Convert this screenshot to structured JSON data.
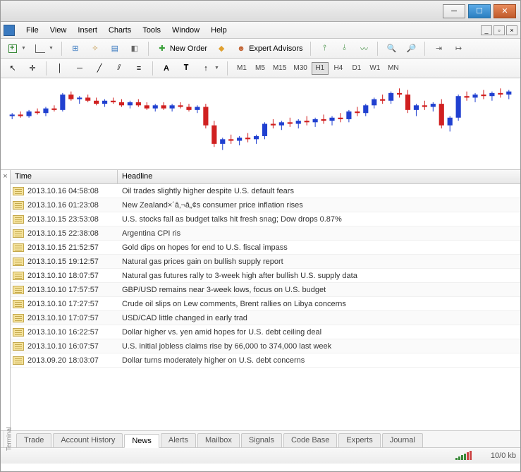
{
  "window": {
    "title": ""
  },
  "menu": [
    "File",
    "View",
    "Insert",
    "Charts",
    "Tools",
    "Window",
    "Help"
  ],
  "toolbar1": {
    "new_order": "New Order",
    "expert_advisors": "Expert Advisors"
  },
  "timeframes": [
    "M1",
    "M5",
    "M15",
    "M30",
    "H1",
    "H4",
    "D1",
    "W1",
    "MN"
  ],
  "active_timeframe": "H1",
  "news_headers": {
    "time": "Time",
    "headline": "Headline"
  },
  "news": [
    {
      "time": "2013.10.16 04:58:08",
      "headline": "Oil trades slightly higher despite U.S. default fears"
    },
    {
      "time": "2013.10.16 01:23:08",
      "headline": "New Zealand×´â‚¬â„¢s consumer price inflation rises"
    },
    {
      "time": "2013.10.15 23:53:08",
      "headline": "U.S. stocks fall as budget talks hit fresh snag; Dow drops 0.87%"
    },
    {
      "time": "2013.10.15 22:38:08",
      "headline": "Argentina CPI ris"
    },
    {
      "time": "2013.10.15 21:52:57",
      "headline": "Gold dips on hopes for end to U.S. fiscal impass"
    },
    {
      "time": "2013.10.15 19:12:57",
      "headline": "Natural gas prices gain on bullish supply report"
    },
    {
      "time": "2013.10.10 18:07:57",
      "headline": "Natural gas futures rally to 3-week high after bullish U.S. supply data"
    },
    {
      "time": "2013.10.10 17:57:57",
      "headline": "GBP/USD remains near 3-week lows, focus on U.S. budget"
    },
    {
      "time": "2013.10.10 17:27:57",
      "headline": "Crude oil slips on Lew comments, Brent rallies on Libya concerns"
    },
    {
      "time": "2013.10.10 17:07:57",
      "headline": "USD/CAD little changed in early trad"
    },
    {
      "time": "2013.10.10 16:22:57",
      "headline": "Dollar higher vs. yen amid hopes for U.S. debt ceiling deal"
    },
    {
      "time": "2013.10.10 16:07:57",
      "headline": "U.S. initial jobless claims rise by 66,000 to 374,000 last week"
    },
    {
      "time": "2013.09.20 18:03:07",
      "headline": "Dollar turns moderately higher on U.S. debt concerns"
    }
  ],
  "tabs": [
    "Trade",
    "Account History",
    "News",
    "Alerts",
    "Mailbox",
    "Signals",
    "Code Base",
    "Experts",
    "Journal"
  ],
  "active_tab": "News",
  "terminal_label": "Terminal",
  "status": {
    "traffic": "10/0 kb"
  },
  "chart_data": {
    "type": "candlestick",
    "title": "",
    "series": [
      {
        "o": 50,
        "h": 52,
        "l": 48,
        "c": 51,
        "d": "u"
      },
      {
        "o": 51,
        "h": 53,
        "l": 49,
        "c": 50,
        "d": "d"
      },
      {
        "o": 50,
        "h": 54,
        "l": 49,
        "c": 53,
        "d": "u"
      },
      {
        "o": 53,
        "h": 55,
        "l": 51,
        "c": 52,
        "d": "d"
      },
      {
        "o": 52,
        "h": 56,
        "l": 50,
        "c": 55,
        "d": "u"
      },
      {
        "o": 55,
        "h": 57,
        "l": 53,
        "c": 54,
        "d": "d"
      },
      {
        "o": 54,
        "h": 65,
        "l": 53,
        "c": 64,
        "d": "u"
      },
      {
        "o": 64,
        "h": 66,
        "l": 60,
        "c": 61,
        "d": "d"
      },
      {
        "o": 61,
        "h": 63,
        "l": 58,
        "c": 62,
        "d": "u"
      },
      {
        "o": 62,
        "h": 64,
        "l": 59,
        "c": 60,
        "d": "d"
      },
      {
        "o": 60,
        "h": 62,
        "l": 57,
        "c": 58,
        "d": "d"
      },
      {
        "o": 58,
        "h": 61,
        "l": 56,
        "c": 60,
        "d": "u"
      },
      {
        "o": 60,
        "h": 62,
        "l": 58,
        "c": 59,
        "d": "d"
      },
      {
        "o": 59,
        "h": 61,
        "l": 56,
        "c": 57,
        "d": "d"
      },
      {
        "o": 57,
        "h": 60,
        "l": 55,
        "c": 59,
        "d": "u"
      },
      {
        "o": 59,
        "h": 61,
        "l": 56,
        "c": 57,
        "d": "d"
      },
      {
        "o": 57,
        "h": 59,
        "l": 54,
        "c": 55,
        "d": "d"
      },
      {
        "o": 55,
        "h": 58,
        "l": 53,
        "c": 57,
        "d": "u"
      },
      {
        "o": 57,
        "h": 59,
        "l": 54,
        "c": 55,
        "d": "d"
      },
      {
        "o": 55,
        "h": 58,
        "l": 53,
        "c": 57,
        "d": "u"
      },
      {
        "o": 57,
        "h": 59,
        "l": 55,
        "c": 56,
        "d": "d"
      },
      {
        "o": 56,
        "h": 58,
        "l": 53,
        "c": 54,
        "d": "d"
      },
      {
        "o": 54,
        "h": 57,
        "l": 52,
        "c": 56,
        "d": "u"
      },
      {
        "o": 56,
        "h": 58,
        "l": 42,
        "c": 44,
        "d": "d"
      },
      {
        "o": 44,
        "h": 47,
        "l": 30,
        "c": 32,
        "d": "d"
      },
      {
        "o": 32,
        "h": 36,
        "l": 28,
        "c": 35,
        "d": "u"
      },
      {
        "o": 35,
        "h": 38,
        "l": 32,
        "c": 34,
        "d": "d"
      },
      {
        "o": 34,
        "h": 37,
        "l": 31,
        "c": 36,
        "d": "u"
      },
      {
        "o": 36,
        "h": 39,
        "l": 33,
        "c": 35,
        "d": "d"
      },
      {
        "o": 35,
        "h": 38,
        "l": 32,
        "c": 37,
        "d": "u"
      },
      {
        "o": 37,
        "h": 46,
        "l": 35,
        "c": 45,
        "d": "u"
      },
      {
        "o": 45,
        "h": 48,
        "l": 42,
        "c": 44,
        "d": "d"
      },
      {
        "o": 44,
        "h": 47,
        "l": 41,
        "c": 46,
        "d": "u"
      },
      {
        "o": 46,
        "h": 49,
        "l": 43,
        "c": 45,
        "d": "d"
      },
      {
        "o": 45,
        "h": 48,
        "l": 42,
        "c": 47,
        "d": "u"
      },
      {
        "o": 47,
        "h": 50,
        "l": 44,
        "c": 46,
        "d": "d"
      },
      {
        "o": 46,
        "h": 49,
        "l": 43,
        "c": 48,
        "d": "u"
      },
      {
        "o": 48,
        "h": 51,
        "l": 45,
        "c": 47,
        "d": "d"
      },
      {
        "o": 47,
        "h": 50,
        "l": 44,
        "c": 49,
        "d": "u"
      },
      {
        "o": 49,
        "h": 52,
        "l": 46,
        "c": 48,
        "d": "d"
      },
      {
        "o": 48,
        "h": 54,
        "l": 46,
        "c": 53,
        "d": "u"
      },
      {
        "o": 53,
        "h": 56,
        "l": 50,
        "c": 52,
        "d": "d"
      },
      {
        "o": 52,
        "h": 58,
        "l": 50,
        "c": 57,
        "d": "u"
      },
      {
        "o": 57,
        "h": 62,
        "l": 55,
        "c": 61,
        "d": "u"
      },
      {
        "o": 61,
        "h": 64,
        "l": 58,
        "c": 60,
        "d": "d"
      },
      {
        "o": 60,
        "h": 66,
        "l": 58,
        "c": 65,
        "d": "u"
      },
      {
        "o": 65,
        "h": 68,
        "l": 62,
        "c": 64,
        "d": "d"
      },
      {
        "o": 64,
        "h": 67,
        "l": 52,
        "c": 54,
        "d": "d"
      },
      {
        "o": 54,
        "h": 58,
        "l": 50,
        "c": 57,
        "d": "u"
      },
      {
        "o": 57,
        "h": 60,
        "l": 54,
        "c": 56,
        "d": "d"
      },
      {
        "o": 56,
        "h": 59,
        "l": 53,
        "c": 58,
        "d": "u"
      },
      {
        "o": 58,
        "h": 61,
        "l": 42,
        "c": 44,
        "d": "d"
      },
      {
        "o": 44,
        "h": 50,
        "l": 40,
        "c": 49,
        "d": "u"
      },
      {
        "o": 49,
        "h": 64,
        "l": 47,
        "c": 63,
        "d": "u"
      },
      {
        "o": 63,
        "h": 66,
        "l": 60,
        "c": 62,
        "d": "d"
      },
      {
        "o": 62,
        "h": 65,
        "l": 59,
        "c": 64,
        "d": "u"
      },
      {
        "o": 64,
        "h": 67,
        "l": 61,
        "c": 63,
        "d": "d"
      },
      {
        "o": 63,
        "h": 66,
        "l": 60,
        "c": 65,
        "d": "u"
      },
      {
        "o": 65,
        "h": 68,
        "l": 62,
        "c": 64,
        "d": "d"
      },
      {
        "o": 64,
        "h": 67,
        "l": 61,
        "c": 66,
        "d": "u"
      }
    ]
  }
}
